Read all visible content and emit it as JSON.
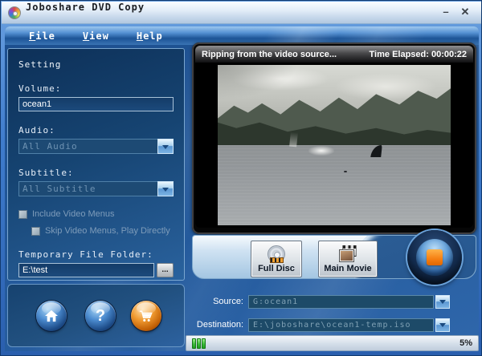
{
  "window": {
    "title": "Joboshare DVD Copy",
    "minimize_glyph": "–",
    "close_glyph": "✕"
  },
  "menu": {
    "items": [
      {
        "mnemonic": "F",
        "rest": "ile"
      },
      {
        "mnemonic": "V",
        "rest": "iew"
      },
      {
        "mnemonic": "H",
        "rest": "elp"
      }
    ]
  },
  "settings": {
    "title": "Setting",
    "volume_label": "Volume:",
    "volume_value": "ocean1",
    "audio_label": "Audio:",
    "audio_value": "All Audio",
    "subtitle_label": "Subtitle:",
    "subtitle_value": "All Subtitle",
    "include_menus_label": "Include Video Menus",
    "skip_menus_label": "Skip Video Menus, Play Directly",
    "temp_folder_label": "Temporary File Folder:",
    "temp_folder_value": "E:\\test",
    "browse_glyph": "..."
  },
  "preview": {
    "status_text": "Ripping from the video source...",
    "time_elapsed": "Time Elapsed: 00:00:22"
  },
  "modes": {
    "full_disc_label": "Full Disc",
    "main_movie_label": "Main Movie"
  },
  "output": {
    "source_label": "Source:",
    "source_value": "G:ocean1",
    "destination_label": "Destination:",
    "destination_value": "E:\\joboshare\\ocean1-temp.iso"
  },
  "footer": {
    "help_glyph": "?",
    "progress_percent": "5%"
  },
  "colors": {
    "frame_blue": "#3f7ccc",
    "panel_navy": "#164472",
    "stop_orange": "#f57f12",
    "progress_green": "#3dbb3d"
  }
}
